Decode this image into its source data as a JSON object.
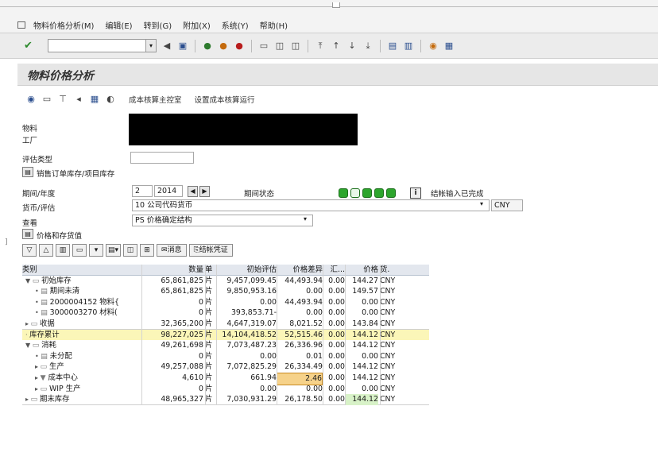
{
  "menu": {
    "items": [
      "物料价格分析(M)",
      "编辑(E)",
      "转到(G)",
      "附加(X)",
      "系统(Y)",
      "帮助(H)"
    ]
  },
  "toolbar": {
    "command_value": "",
    "icons": [
      "check-icon",
      "back-icon",
      "save-icon",
      "back-green-icon",
      "exit-icon",
      "cancel-icon",
      "print-icon",
      "find-icon",
      "find-next-icon",
      "first-page-icon",
      "prev-page-icon",
      "next-page-icon",
      "last-page-icon",
      "new-session-icon",
      "shortcut-icon",
      "help-icon",
      "layout-icon"
    ]
  },
  "title": "物料价格分析",
  "app_toolbar": {
    "link1": "成本核算主控室",
    "link2": "设置成本核算运行"
  },
  "form": {
    "material_label": "物料",
    "plant_label": "工厂",
    "valuation_type_label": "评估类型",
    "sales_stock_btn": "销售订单库存/项目库存",
    "period_label": "期间/年度",
    "period_value": "2",
    "year_value": "2014",
    "period_status_label": "期间状态",
    "closing_status": "结帐输入已完成",
    "currency_label": "货币/评估",
    "currency_value": "10 公司代码货币",
    "currency_code": "CNY",
    "view_label": "查看",
    "view_value": "PS 价格确定结构",
    "price_stock_btn": "价格和存货值"
  },
  "alv": {
    "msg_btn": "消息",
    "closing_btn": "结帐凭证"
  },
  "grid": {
    "headers": {
      "category": "类别",
      "qty": "数量",
      "unit": "单",
      "init": "初始评估",
      "diff": "价格差异",
      "sum": "汇...",
      "price": "价格",
      "cur": "货."
    },
    "rows": [
      {
        "indent": 0,
        "marker": "▼",
        "icon": "folder-open",
        "category": "初始库存",
        "qty": "65,861,825",
        "unit": "片",
        "init": "9,457,099.45",
        "diff": "44,493.94",
        "sum": "0.00",
        "price": "144.27",
        "cur": "CNY"
      },
      {
        "indent": 1,
        "marker": "•",
        "icon": "doc",
        "category": "期间未清",
        "qty": "65,861,825",
        "unit": "片",
        "init": "9,850,953.16",
        "diff": "0.00",
        "sum": "0.00",
        "price": "149.57",
        "cur": "CNY"
      },
      {
        "indent": 1,
        "marker": "•",
        "icon": "doc",
        "category": "2000004152 物料{",
        "qty": "0",
        "unit": "片",
        "init": "0.00",
        "diff": "44,493.94",
        "sum": "0.00",
        "price": "0.00",
        "cur": "CNY"
      },
      {
        "indent": 1,
        "marker": "•",
        "icon": "doc",
        "category": "3000003270 材料(",
        "qty": "0",
        "unit": "片",
        "init": "393,853.71-",
        "diff": "0.00",
        "sum": "0.00",
        "price": "0.00",
        "cur": "CNY"
      },
      {
        "indent": 0,
        "marker": "▸",
        "icon": "folder",
        "category": "收据",
        "qty": "32,365,200",
        "unit": "片",
        "init": "4,647,319.07",
        "diff": "8,021.52",
        "sum": "0.00",
        "price": "143.84",
        "cur": "CNY",
        "sep": true
      },
      {
        "indent": 0,
        "marker": "·",
        "icon": "none",
        "category": "库存累计",
        "qty": "98,227,025",
        "unit": "片",
        "init": "14,104,418.52",
        "diff": "52,515.46",
        "sum": "0.00",
        "price": "144.12",
        "cur": "CNY",
        "hl": true
      },
      {
        "indent": 0,
        "marker": "▼",
        "icon": "folder-open",
        "category": "消耗",
        "qty": "49,261,698",
        "unit": "片",
        "init": "7,073,487.23",
        "diff": "26,336.96",
        "sum": "0.00",
        "price": "144.12",
        "cur": "CNY"
      },
      {
        "indent": 1,
        "marker": "•",
        "icon": "doc",
        "category": "未分配",
        "qty": "0",
        "unit": "片",
        "init": "0.00",
        "diff": "0.01",
        "sum": "0.00",
        "price": "0.00",
        "cur": "CNY"
      },
      {
        "indent": 1,
        "marker": "▸",
        "icon": "folder",
        "category": "生产",
        "qty": "49,257,088",
        "unit": "片",
        "init": "7,072,825.29",
        "diff": "26,334.49",
        "sum": "0.00",
        "price": "144.12",
        "cur": "CNY"
      },
      {
        "indent": 1,
        "marker": "▸",
        "icon": "filter",
        "category": "成本中心",
        "qty": "4,610",
        "unit": "片",
        "init": "661.94",
        "diff": "2.46",
        "sum": "0.00",
        "price": "144.12",
        "cur": "CNY",
        "focus": true
      },
      {
        "indent": 1,
        "marker": "▸",
        "icon": "folder",
        "category": "WIP 生产",
        "qty": "0",
        "unit": "片",
        "init": "0.00",
        "diff": "0.00",
        "sum": "0.00",
        "price": "0.00",
        "cur": "CNY"
      },
      {
        "indent": 0,
        "marker": "▸",
        "icon": "folder",
        "category": "期末库存",
        "qty": "48,965,327",
        "unit": "片",
        "init": "7,030,931.29",
        "diff": "26,178.50",
        "sum": "0.00",
        "price": "144.12",
        "cur": "CNY",
        "green": true,
        "sep": true
      }
    ]
  }
}
